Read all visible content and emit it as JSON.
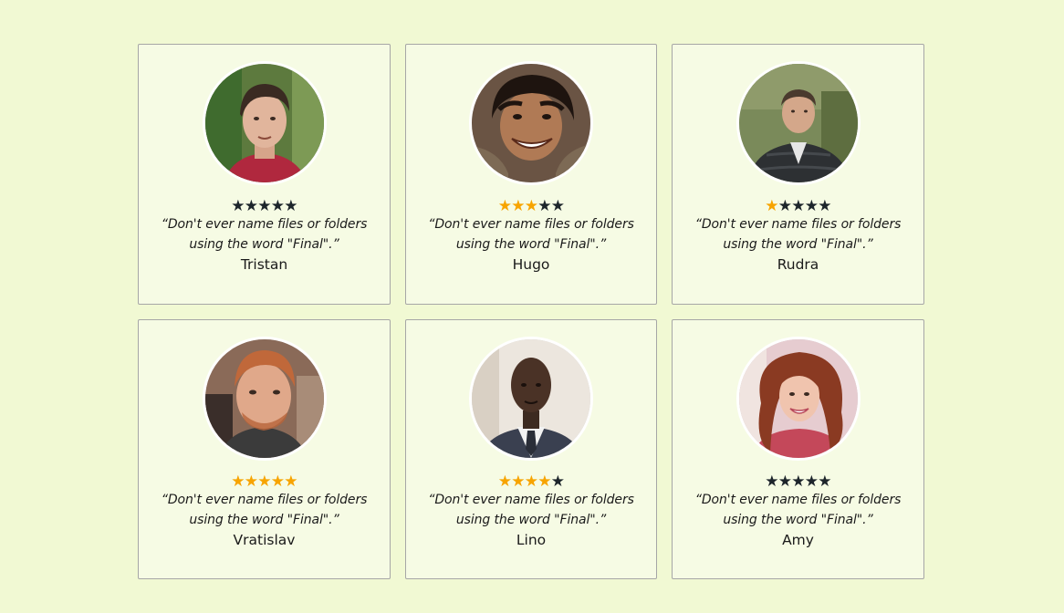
{
  "colors": {
    "background": "#f1f9d3",
    "card_background": "#f6fbe4",
    "star_filled": "#f7a400",
    "star_empty": "#1d252b"
  },
  "testimonials": [
    {
      "name": "Tristan",
      "quote": "“Don't ever name files or folders using the word \"Final\".”",
      "rating": 0,
      "max_rating": 5,
      "avatar_icon": "man-dark-hair-red-shirt-avatar"
    },
    {
      "name": "Hugo",
      "quote": "“Don't ever name files or folders using the word \"Final\".”",
      "rating": 3,
      "max_rating": 5,
      "avatar_icon": "man-smiling-long-hair-avatar"
    },
    {
      "name": "Rudra",
      "quote": "“Don't ever name files or folders using the word \"Final\".”",
      "rating": 1,
      "max_rating": 5,
      "avatar_icon": "man-puffer-jacket-avatar"
    },
    {
      "name": "Vratislav",
      "quote": "“Don't ever name files or folders using the word \"Final\".”",
      "rating": 5,
      "max_rating": 5,
      "avatar_icon": "man-red-hair-beard-avatar"
    },
    {
      "name": "Lino",
      "quote": "“Don't ever name files or folders using the word \"Final\".”",
      "rating": 4,
      "max_rating": 5,
      "avatar_icon": "man-suit-tie-avatar"
    },
    {
      "name": "Amy",
      "quote": "“Don't ever name files or folders using the word \"Final\".”",
      "rating": 0,
      "max_rating": 5,
      "avatar_icon": "woman-curly-hair-avatar"
    }
  ]
}
